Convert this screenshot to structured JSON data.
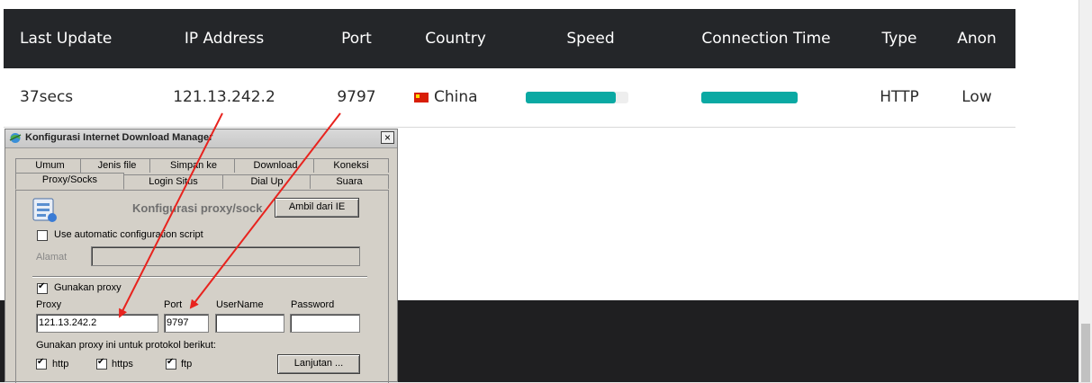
{
  "table": {
    "headers": [
      "Last Update",
      "IP Address",
      "Port",
      "Country",
      "Speed",
      "Connection Time",
      "Type",
      "Anon"
    ],
    "row": {
      "last_update": "37secs",
      "ip": "121.13.242.2",
      "port": "9797",
      "country": "China",
      "speed_fraction": 0.88,
      "connection_time_fraction": 1.0,
      "type": "HTTP",
      "anon": "Low"
    },
    "bar_color": "#0aa9a3",
    "header_bg": "#242629"
  },
  "dialog": {
    "title": "Konfigurasi Internet Download Manager",
    "close_glyph": "×",
    "tabs_row1": [
      "Umum",
      "Jenis file",
      "Simpan ke",
      "Download",
      "Koneksi"
    ],
    "tabs_row2": [
      "Proxy/Socks",
      "Login Situs",
      "Dial Up",
      "Suara"
    ],
    "section_title": "Konfigurasi proxy/sock",
    "ambil_button": "Ambil dari IE",
    "auto_config_label": "Use automatic configuration script",
    "alamat_label": "Alamat",
    "gunakan_proxy_label": "Gunakan proxy",
    "proxy_label": "Proxy",
    "port_label": "Port",
    "username_label": "UserName",
    "password_label": "Password",
    "proxy_value": "121.13.242.2",
    "port_value": "9797",
    "protocol_label": "Gunakan proxy ini untuk protokol berikut:",
    "http_label": "http",
    "https_label": "https",
    "ftp_label": "ftp",
    "lanjutan_button": "Lanjutan ..."
  },
  "arrow_color": "#e8231e"
}
